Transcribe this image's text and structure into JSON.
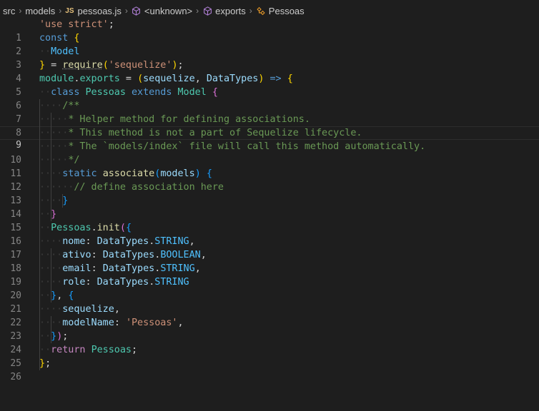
{
  "breadcrumb": {
    "parts": [
      "src",
      "models",
      "pessoas.js",
      "<unknown>",
      "exports",
      "Pessoas"
    ],
    "file_badge": "JS"
  },
  "editor": {
    "active_line": 9,
    "line_numbers": [
      "1",
      "2",
      "3",
      "4",
      "5",
      "6",
      "7",
      "8",
      "9",
      "10",
      "11",
      "12",
      "13",
      "14",
      "15",
      "16",
      "17",
      "18",
      "19",
      "20",
      "21",
      "22",
      "23",
      "24",
      "25",
      "26"
    ]
  },
  "code": [
    [
      "'use strict'",
      ";"
    ],
    [
      "const",
      " ",
      "{"
    ],
    [
      "Model"
    ],
    [
      "}",
      " = ",
      "require",
      "(",
      "'sequelize'",
      ")",
      ";"
    ],
    [
      "module",
      ".",
      "exports",
      " = ",
      "(",
      "sequelize",
      ", ",
      "DataTypes",
      ")",
      " => ",
      "{"
    ],
    [
      "class",
      " ",
      "Pessoas",
      " ",
      "extends",
      " ",
      "Model",
      " ",
      "{"
    ],
    [
      "/**"
    ],
    [
      "* Helper method for defining associations."
    ],
    [
      "* This method is not a part of Sequelize lifecycle."
    ],
    [
      "* The `models/index` file will call this method automatically."
    ],
    [
      "*/"
    ],
    [
      "static",
      " ",
      "associate",
      "(",
      "models",
      ")",
      " ",
      "{"
    ],
    [
      "// define association here"
    ],
    [
      "}"
    ],
    [
      "}"
    ],
    [
      "Pessoas",
      ".",
      "init",
      "(",
      "{"
    ],
    [
      "nome",
      ": ",
      "DataTypes",
      ".",
      "STRING",
      ","
    ],
    [
      "ativo",
      ": ",
      "DataTypes",
      ".",
      "BOOLEAN",
      ","
    ],
    [
      "email",
      ": ",
      "DataTypes",
      ".",
      "STRING",
      ","
    ],
    [
      "role",
      ": ",
      "DataTypes",
      ".",
      "STRING"
    ],
    [
      "}",
      ", ",
      "{"
    ],
    [
      "sequelize",
      ","
    ],
    [
      "modelName",
      ": ",
      "'Pessoas'",
      ","
    ],
    [
      "}",
      ")",
      ";"
    ],
    [
      "return",
      " ",
      "Pessoas",
      ";"
    ],
    [
      "}",
      ";"
    ]
  ]
}
